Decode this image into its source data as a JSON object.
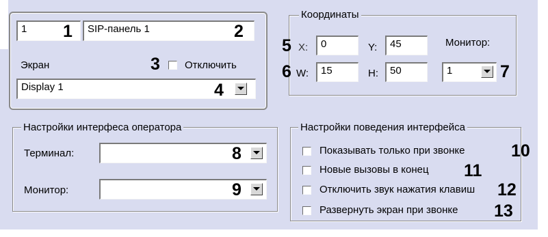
{
  "general": {
    "id_value": "1",
    "name_value": "SIP-панель 1",
    "screen_label": "Экран",
    "disable_label": "Отключить",
    "screen_value": "Display 1"
  },
  "coordinates": {
    "title": "Координаты",
    "x_label": "X:",
    "x_value": "0",
    "y_label": "Y:",
    "y_value": "45",
    "w_label": "W:",
    "w_value": "15",
    "h_label": "H:",
    "h_value": "50",
    "monitor_label": "Монитор:",
    "monitor_value": "1"
  },
  "operator_settings": {
    "title": "Настройки интерфеса оператора",
    "terminal_label": "Терминал:",
    "terminal_value": "",
    "monitor_label": "Монитор:",
    "monitor_value": ""
  },
  "behavior_settings": {
    "title": "Настройки поведения интерфейса",
    "options": [
      "Показывать только при звонке",
      "Новые вызовы в конец",
      "Отключить звук нажатия клавиш",
      "Развернуть экран при звонке"
    ]
  },
  "callouts": [
    "1",
    "2",
    "3",
    "4",
    "5",
    "6",
    "7",
    "8",
    "9",
    "10",
    "11",
    "12",
    "13"
  ],
  "colors": {
    "panel_bg": "#d9dcf0",
    "field_bg": "#ffffff"
  }
}
